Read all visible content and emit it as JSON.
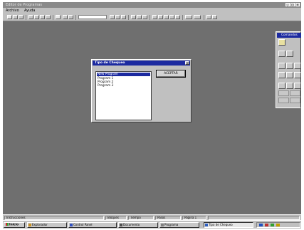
{
  "window": {
    "title": "Editor de Programas",
    "controls": [
      "_",
      "□",
      "×"
    ]
  },
  "menubar": {
    "items": [
      "Archivo",
      "Ayuda"
    ]
  },
  "dialog": {
    "title": "Tipo de Chequeo",
    "close_label": "×",
    "list_items": [
      "New Program",
      "Program 1",
      "Program 2",
      "Program 3"
    ],
    "selected_index": 0,
    "accept_label": "ACEPTAR"
  },
  "palette": {
    "title": "Comandos"
  },
  "statusbar": {
    "panels": [
      "Instrucciones",
      "Bloques",
      "Tiempo",
      "Pasos",
      "Pagina 1"
    ]
  },
  "taskbar": {
    "start_label": "Inicio",
    "tasks": [
      {
        "label": "Explorador",
        "icon_color": "#c89020"
      },
      {
        "label": "Control Panel",
        "icon_color": "#3050c0"
      },
      {
        "label": "Documento",
        "icon_color": "#505050"
      },
      {
        "label": "Programa",
        "icon_color": "#808080"
      },
      {
        "label": "Tipo de Chequeo",
        "icon_color": "#3060c0"
      }
    ],
    "tray_icon_colors": [
      "#2050c0",
      "#c03030",
      "#30a030",
      "#c0a000"
    ]
  },
  "colors": {
    "workspace": "#6f6f6f",
    "face": "#c0c0c0",
    "titlebar_active": "#1c2aa0",
    "selection": "#1c2aa0"
  }
}
